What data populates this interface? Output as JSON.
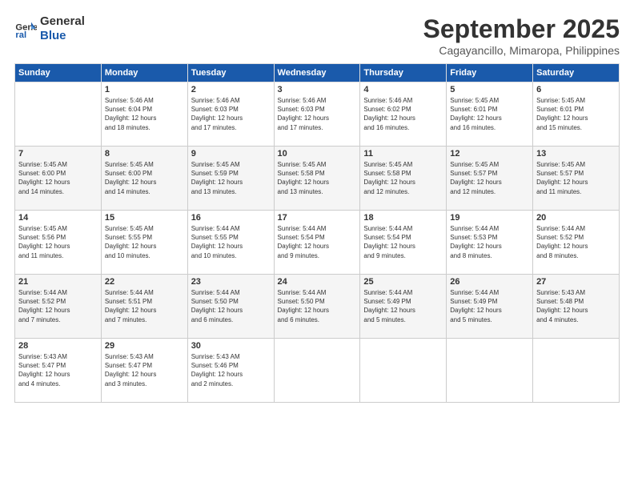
{
  "logo": {
    "line1": "General",
    "line2": "Blue"
  },
  "header": {
    "month": "September 2025",
    "location": "Cagayancillo, Mimaropa, Philippines"
  },
  "days_of_week": [
    "Sunday",
    "Monday",
    "Tuesday",
    "Wednesday",
    "Thursday",
    "Friday",
    "Saturday"
  ],
  "weeks": [
    [
      {
        "day": "",
        "content": ""
      },
      {
        "day": "1",
        "content": "Sunrise: 5:46 AM\nSunset: 6:04 PM\nDaylight: 12 hours\nand 18 minutes."
      },
      {
        "day": "2",
        "content": "Sunrise: 5:46 AM\nSunset: 6:03 PM\nDaylight: 12 hours\nand 17 minutes."
      },
      {
        "day": "3",
        "content": "Sunrise: 5:46 AM\nSunset: 6:03 PM\nDaylight: 12 hours\nand 17 minutes."
      },
      {
        "day": "4",
        "content": "Sunrise: 5:46 AM\nSunset: 6:02 PM\nDaylight: 12 hours\nand 16 minutes."
      },
      {
        "day": "5",
        "content": "Sunrise: 5:45 AM\nSunset: 6:01 PM\nDaylight: 12 hours\nand 16 minutes."
      },
      {
        "day": "6",
        "content": "Sunrise: 5:45 AM\nSunset: 6:01 PM\nDaylight: 12 hours\nand 15 minutes."
      }
    ],
    [
      {
        "day": "7",
        "content": "Sunrise: 5:45 AM\nSunset: 6:00 PM\nDaylight: 12 hours\nand 14 minutes."
      },
      {
        "day": "8",
        "content": "Sunrise: 5:45 AM\nSunset: 6:00 PM\nDaylight: 12 hours\nand 14 minutes."
      },
      {
        "day": "9",
        "content": "Sunrise: 5:45 AM\nSunset: 5:59 PM\nDaylight: 12 hours\nand 13 minutes."
      },
      {
        "day": "10",
        "content": "Sunrise: 5:45 AM\nSunset: 5:58 PM\nDaylight: 12 hours\nand 13 minutes."
      },
      {
        "day": "11",
        "content": "Sunrise: 5:45 AM\nSunset: 5:58 PM\nDaylight: 12 hours\nand 12 minutes."
      },
      {
        "day": "12",
        "content": "Sunrise: 5:45 AM\nSunset: 5:57 PM\nDaylight: 12 hours\nand 12 minutes."
      },
      {
        "day": "13",
        "content": "Sunrise: 5:45 AM\nSunset: 5:57 PM\nDaylight: 12 hours\nand 11 minutes."
      }
    ],
    [
      {
        "day": "14",
        "content": "Sunrise: 5:45 AM\nSunset: 5:56 PM\nDaylight: 12 hours\nand 11 minutes."
      },
      {
        "day": "15",
        "content": "Sunrise: 5:45 AM\nSunset: 5:55 PM\nDaylight: 12 hours\nand 10 minutes."
      },
      {
        "day": "16",
        "content": "Sunrise: 5:44 AM\nSunset: 5:55 PM\nDaylight: 12 hours\nand 10 minutes."
      },
      {
        "day": "17",
        "content": "Sunrise: 5:44 AM\nSunset: 5:54 PM\nDaylight: 12 hours\nand 9 minutes."
      },
      {
        "day": "18",
        "content": "Sunrise: 5:44 AM\nSunset: 5:54 PM\nDaylight: 12 hours\nand 9 minutes."
      },
      {
        "day": "19",
        "content": "Sunrise: 5:44 AM\nSunset: 5:53 PM\nDaylight: 12 hours\nand 8 minutes."
      },
      {
        "day": "20",
        "content": "Sunrise: 5:44 AM\nSunset: 5:52 PM\nDaylight: 12 hours\nand 8 minutes."
      }
    ],
    [
      {
        "day": "21",
        "content": "Sunrise: 5:44 AM\nSunset: 5:52 PM\nDaylight: 12 hours\nand 7 minutes."
      },
      {
        "day": "22",
        "content": "Sunrise: 5:44 AM\nSunset: 5:51 PM\nDaylight: 12 hours\nand 7 minutes."
      },
      {
        "day": "23",
        "content": "Sunrise: 5:44 AM\nSunset: 5:50 PM\nDaylight: 12 hours\nand 6 minutes."
      },
      {
        "day": "24",
        "content": "Sunrise: 5:44 AM\nSunset: 5:50 PM\nDaylight: 12 hours\nand 6 minutes."
      },
      {
        "day": "25",
        "content": "Sunrise: 5:44 AM\nSunset: 5:49 PM\nDaylight: 12 hours\nand 5 minutes."
      },
      {
        "day": "26",
        "content": "Sunrise: 5:44 AM\nSunset: 5:49 PM\nDaylight: 12 hours\nand 5 minutes."
      },
      {
        "day": "27",
        "content": "Sunrise: 5:43 AM\nSunset: 5:48 PM\nDaylight: 12 hours\nand 4 minutes."
      }
    ],
    [
      {
        "day": "28",
        "content": "Sunrise: 5:43 AM\nSunset: 5:47 PM\nDaylight: 12 hours\nand 4 minutes."
      },
      {
        "day": "29",
        "content": "Sunrise: 5:43 AM\nSunset: 5:47 PM\nDaylight: 12 hours\nand 3 minutes."
      },
      {
        "day": "30",
        "content": "Sunrise: 5:43 AM\nSunset: 5:46 PM\nDaylight: 12 hours\nand 2 minutes."
      },
      {
        "day": "",
        "content": ""
      },
      {
        "day": "",
        "content": ""
      },
      {
        "day": "",
        "content": ""
      },
      {
        "day": "",
        "content": ""
      }
    ]
  ]
}
